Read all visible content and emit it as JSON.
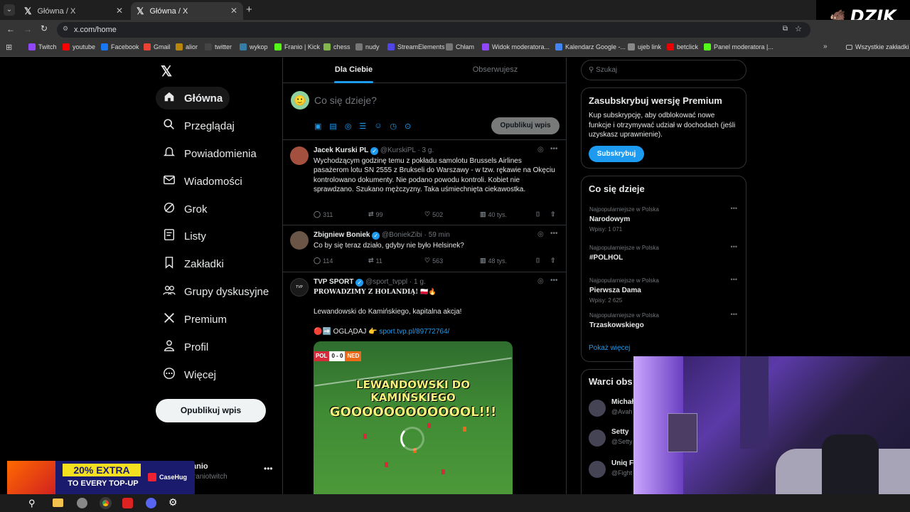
{
  "browser": {
    "tabs": [
      {
        "title": "Główna / X",
        "active": false
      },
      {
        "title": "Główna / X",
        "active": true
      }
    ],
    "url": "x.com/home",
    "bookmarks": [
      {
        "label": "Twitch",
        "color": "#9146ff"
      },
      {
        "label": "youtube",
        "color": "#ff0000"
      },
      {
        "label": "Facebook",
        "color": "#1877f2"
      },
      {
        "label": "Gmail",
        "color": "#ea4335"
      },
      {
        "label": "alior",
        "color": "#b8860b"
      },
      {
        "label": "twitter",
        "color": "#444444"
      },
      {
        "label": "wykop",
        "color": "#367da6"
      },
      {
        "label": "Franio | Kick",
        "color": "#53fc18"
      },
      {
        "label": "chess",
        "color": "#81b64c"
      },
      {
        "label": "nudy",
        "color": "#777777"
      },
      {
        "label": "StreamElements",
        "color": "#4f46e5"
      },
      {
        "label": "Chłam",
        "color": "#777777"
      },
      {
        "label": "Widok moderatora...",
        "color": "#9146ff"
      },
      {
        "label": "Kalendarz Google -...",
        "color": "#4285f4"
      },
      {
        "label": "ujeb link",
        "color": "#888888"
      },
      {
        "label": "betclick",
        "color": "#e60000"
      },
      {
        "label": "Panel moderatora |...",
        "color": "#53fc18"
      }
    ],
    "all_bookmarks": "Wszystkie zakładki"
  },
  "brand_overlay": "DZIK",
  "sidebar": {
    "items": [
      {
        "label": "Główna",
        "icon": "home-icon"
      },
      {
        "label": "Przeglądaj",
        "icon": "search-icon"
      },
      {
        "label": "Powiadomienia",
        "icon": "bell-icon"
      },
      {
        "label": "Wiadomości",
        "icon": "mail-icon"
      },
      {
        "label": "Grok",
        "icon": "grok-icon"
      },
      {
        "label": "Listy",
        "icon": "list-icon"
      },
      {
        "label": "Zakładki",
        "icon": "bookmark-icon"
      },
      {
        "label": "Grupy dyskusyjne",
        "icon": "people-icon"
      },
      {
        "label": "Premium",
        "icon": "x-logo-icon"
      },
      {
        "label": "Profil",
        "icon": "person-icon"
      },
      {
        "label": "Więcej",
        "icon": "more-icon"
      }
    ],
    "post_button": "Opublikuj wpis",
    "account": {
      "name": "Franio",
      "handle": "@franiotwitch"
    }
  },
  "feed": {
    "tabs": [
      "Dla Ciebie",
      "Obserwujesz"
    ],
    "composer_placeholder": "Co się dzieje?",
    "composer_button": "Opublikuj wpis",
    "tweets": [
      {
        "name": "Jacek Kurski PL",
        "handle": "@KurskiPL",
        "time": "· 3 g.",
        "text": "Wychodzącym godzinę temu z pokładu samolotu Brussels Airlines pasażerom  lotu SN 2555 z Brukseli do Warszawy - w tzw. rękawie na Okęciu kontrolowano dokumenty. Nie podano powodu kontroli. Kobiet nie sprawdzano. Szukano mężczyzny. Taka uśmiechnięta ciekawostka.",
        "replies": "311",
        "reposts": "99",
        "likes": "502",
        "views": "40 tys."
      },
      {
        "name": "Zbigniew Boniek",
        "handle": "@BoniekZibi",
        "time": "· 59 min",
        "text": "Co by się teraz działo, gdyby nie było Helsinek?",
        "replies": "114",
        "reposts": "11",
        "likes": "563",
        "views": "48 tys."
      },
      {
        "name": "TVP SPORT",
        "handle": "@sport_tvppl",
        "time": "· 1 g.",
        "line1": "PROWADZIMY Z HOLANDIĄ! 🇵🇱🔥",
        "line2": "Lewandowski do Kamińskiego, kapitalna akcja!",
        "line3_prefix": "🔴➡️ OGLĄDAJ 👉",
        "link": "sport.tvp.pl/89772764/",
        "video": {
          "score_left": "POL",
          "score": "0 - 0",
          "score_right": "NED",
          "caption1": "LEWANDOWSKI DO KAMIŃSKIEGO",
          "caption2": "GOOOOOOOOOOOOL!!!"
        }
      }
    ]
  },
  "right": {
    "search_placeholder": "Szukaj",
    "premium": {
      "title": "Zasubskrybuj wersję Premium",
      "text": "Kup subskrypcję, aby odblokować nowe funkcje i otrzymywać udział w dochodach (jeśli uzyskasz uprawnienie).",
      "button": "Subskrybuj"
    },
    "trends_title": "Co się dzieje",
    "trends": [
      {
        "context": "Najpopularniejsze w Polska",
        "name": "Narodowym",
        "posts": "Wpisy: 1 071"
      },
      {
        "context": "Najpopularniejsze w Polska",
        "name": "#POLHOL",
        "posts": ""
      },
      {
        "context": "Najpopularniejsze w Polska",
        "name": "Pierwsza Dama",
        "posts": "Wpisy: 2 625"
      },
      {
        "context": "Najpopularniejsze w Polska",
        "name": "Trzaskowskiego",
        "posts": ""
      }
    ],
    "show_more": "Pokaż więcej",
    "follow_title": "Warci obs",
    "follow": [
      {
        "name": "Michał",
        "handle": "@Avah"
      },
      {
        "name": "Setty",
        "handle": "@Setty"
      },
      {
        "name": "Uniq Fi",
        "handle": "@Fight"
      }
    ]
  },
  "ad": {
    "line1": "20% EXTRA",
    "line2": "TO EVERY TOP-UP",
    "brand": "CaseHug"
  }
}
